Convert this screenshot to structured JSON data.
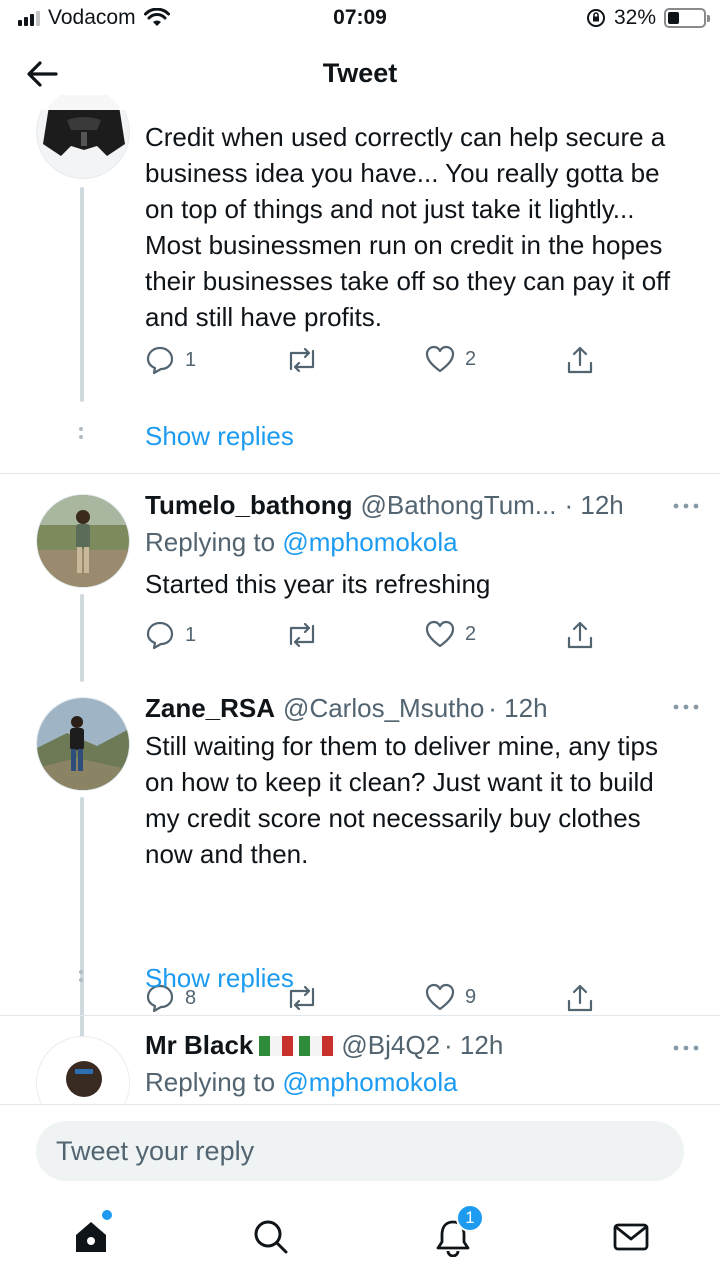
{
  "status_bar": {
    "carrier": "Vodacom",
    "time": "07:09",
    "battery": "32%",
    "battery_level": 0.32
  },
  "header": {
    "title": "Tweet",
    "back_icon": "arrow-left-icon"
  },
  "tweets": [
    {
      "name": "",
      "handle": "",
      "text": "Credit when used correctly can help secure a business idea you have... You really gotta be on top of things and not just take it lightly... Most businessmen run on credit in the hopes their businesses take off so they can pay it off and still have profits.",
      "replies": "1",
      "likes": "2",
      "show_replies": "Show replies"
    },
    {
      "name": "Tumelo_bathong",
      "handle": "@BathongTum...",
      "time": "· 12h",
      "replying_prefix": "Replying to",
      "replying_to": "@mphomokola",
      "text": "Started this year its  refreshing",
      "replies": "1",
      "likes": "2"
    },
    {
      "name": "Zane_RSA",
      "handle": "@Carlos_Msutho",
      "time": "· 12h",
      "text": "Still waiting for them to deliver mine,  any tips on how to keep it clean? Just want it to build my credit score not necessarily buy clothes now and then.",
      "replies": "8",
      "likes": "9",
      "show_replies": "Show replies"
    },
    {
      "name": "Mr Black",
      "handle": "@Bj4Q2",
      "time": "· 12h",
      "replying_prefix": "Replying to",
      "replying_to": "@mphomokola"
    }
  ],
  "reply_box": {
    "placeholder": "Tweet your reply"
  },
  "tab_bar": {
    "notifications_badge": "1"
  },
  "colors": {
    "accent": "#1d9bf0",
    "text": "#0f1419",
    "muted": "#536471"
  }
}
